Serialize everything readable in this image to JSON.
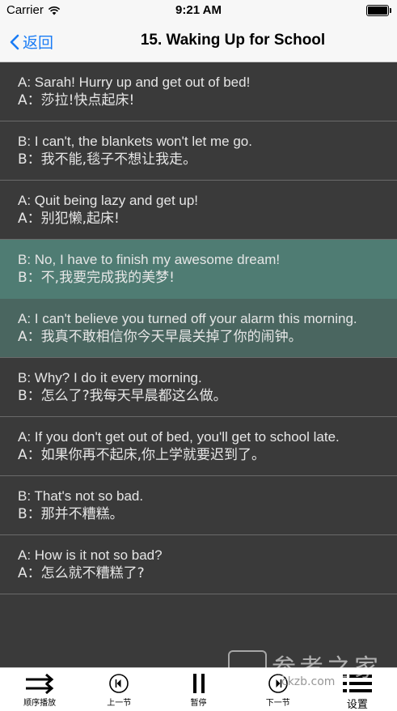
{
  "status": {
    "carrier": "Carrier",
    "time": "9:21 AM"
  },
  "nav": {
    "back_label": "返回",
    "title": "15. Waking Up for School"
  },
  "dialogue": [
    {
      "en": "A: Sarah! Hurry up and get out of bed!",
      "zh": "A：莎拉!快点起床!"
    },
    {
      "en": "B: I can't, the blankets won't let me go.",
      "zh": "B：我不能,毯子不想让我走。"
    },
    {
      "en": "A: Quit being lazy and get up!",
      "zh": "A：别犯懒,起床!"
    },
    {
      "en": "B: No, I have to finish my awesome dream!",
      "zh": "B：不,我要完成我的美梦!"
    },
    {
      "en": "A: I can't believe you turned off your alarm this morning.",
      "zh": "A：我真不敢相信你今天早晨关掉了你的闹钟。"
    },
    {
      "en": "B: Why? I do it every morning.",
      "zh": "B：怎么了?我每天早晨都这么做。"
    },
    {
      "en": "A: If you don't get out of bed, you'll get to school late.",
      "zh": "A：如果你再不起床,你上学就要迟到了。"
    },
    {
      "en": "B: That's not so bad.",
      "zh": "B：那并不糟糕。"
    },
    {
      "en": "A: How is it not so bad?",
      "zh": "A：怎么就不糟糕了?"
    }
  ],
  "tabs": {
    "order": "顺序播放",
    "prev": "上一节",
    "pause": "暂停",
    "next": "下一节",
    "settings": "设置"
  },
  "watermark": {
    "text": "参考之家",
    "url": "ckzb.com"
  },
  "colors": {
    "accent": "#1a7cf5",
    "highlight": "#4f7c73",
    "list_bg": "#3a3a3a"
  }
}
